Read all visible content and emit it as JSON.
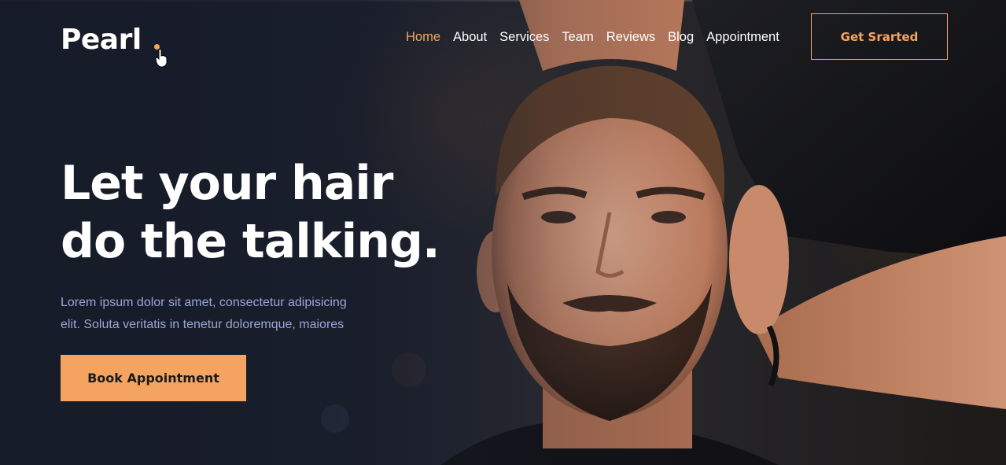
{
  "brand": {
    "name": "Pearl",
    "accent_color": "#f4a460"
  },
  "nav": {
    "items": [
      {
        "label": "Home",
        "active": true
      },
      {
        "label": "About",
        "active": false
      },
      {
        "label": "Services",
        "active": false
      },
      {
        "label": "Team",
        "active": false
      },
      {
        "label": "Reviews",
        "active": false
      },
      {
        "label": "Blog",
        "active": false
      },
      {
        "label": "Appointment",
        "active": false
      }
    ],
    "cta_label": "Get Srarted"
  },
  "hero": {
    "headline_line1": "Let your hair",
    "headline_line2": "do the talking.",
    "lead_line1": "Lorem ipsum dolor sit amet, consectetur adipisicing",
    "lead_line2": "elit. Soluta veritatis in tenetur doloremque, maiores",
    "button_label": "Book Appointment"
  },
  "icons": {
    "cursor": "hand-pointer-icon"
  }
}
